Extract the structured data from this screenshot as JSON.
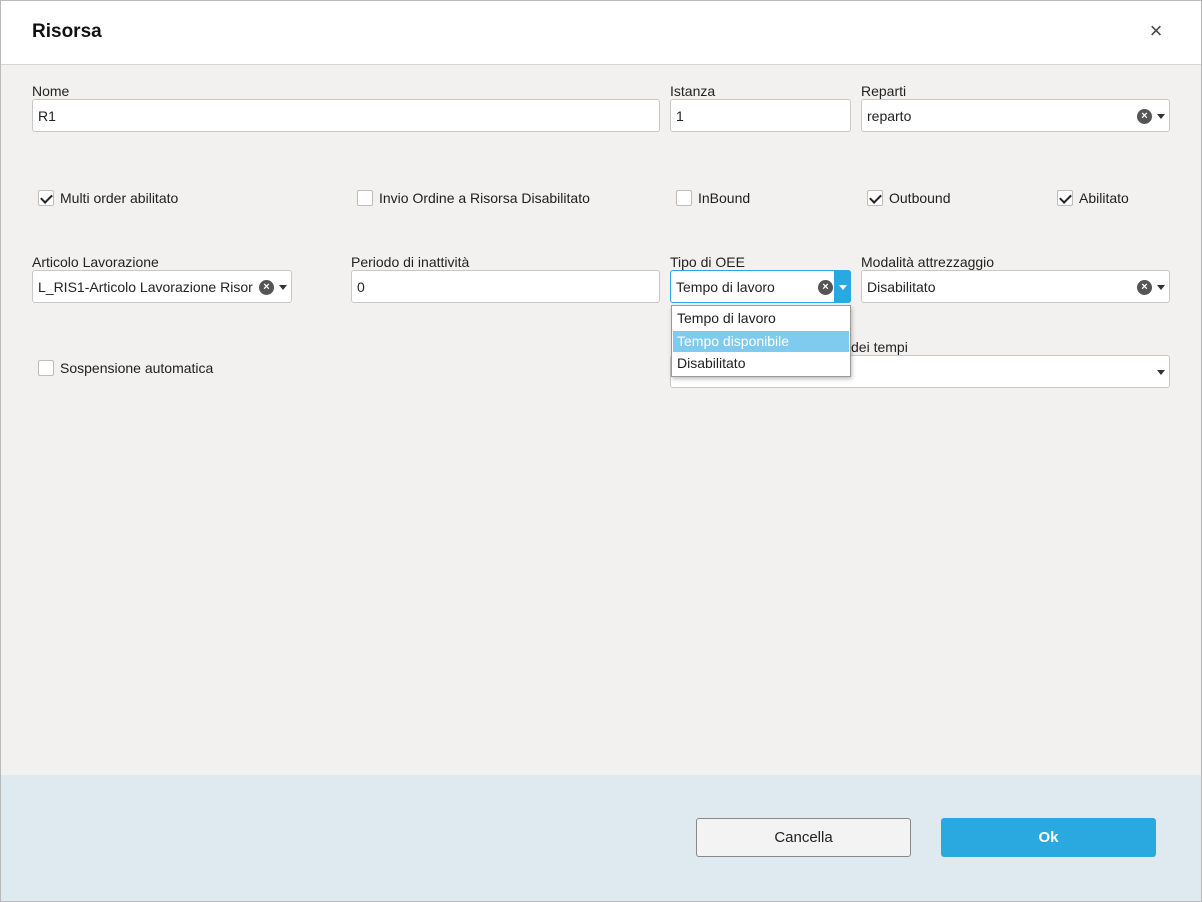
{
  "dialog": {
    "title": "Risorsa",
    "close_icon": "close-icon"
  },
  "fields": {
    "nome": {
      "label": "Nome",
      "value": "R1"
    },
    "istanza": {
      "label": "Istanza",
      "value": "1"
    },
    "reparti": {
      "label": "Reparti",
      "value": "reparto"
    },
    "articolo": {
      "label": "Articolo Lavorazione",
      "value": "L_RIS1-Articolo Lavorazione Risor..."
    },
    "periodo": {
      "label": "Periodo di inattività",
      "value": "0"
    },
    "tipo_oee": {
      "label": "Tipo di OEE",
      "value": "Tempo di lavoro"
    },
    "modalita": {
      "label": "Modalità attrezzaggio",
      "value": "Disabilitato"
    },
    "tempi": {
      "label_partial": "dei tempi",
      "value": ""
    }
  },
  "checkboxes": {
    "multi_order": {
      "label": "Multi order abilitato",
      "checked": true
    },
    "invio_ordine": {
      "label": "Invio Ordine a Risorsa Disabilitato",
      "checked": false
    },
    "inbound": {
      "label": "InBound",
      "checked": false
    },
    "outbound": {
      "label": "Outbound",
      "checked": true
    },
    "abilitato": {
      "label": "Abilitato",
      "checked": true
    },
    "sospensione": {
      "label": "Sospensione automatica",
      "checked": false
    }
  },
  "oee_dropdown": {
    "options": [
      "Tempo di lavoro",
      "Tempo disponibile",
      "Disabilitato"
    ],
    "highlighted": "Tempo disponibile"
  },
  "footer": {
    "cancel_label": "Cancella",
    "ok_label": "Ok"
  },
  "colors": {
    "accent": "#2aa8e0",
    "highlight": "#7ecbef",
    "footer_bg": "#deeaef",
    "body_bg": "#f2f1ef"
  }
}
